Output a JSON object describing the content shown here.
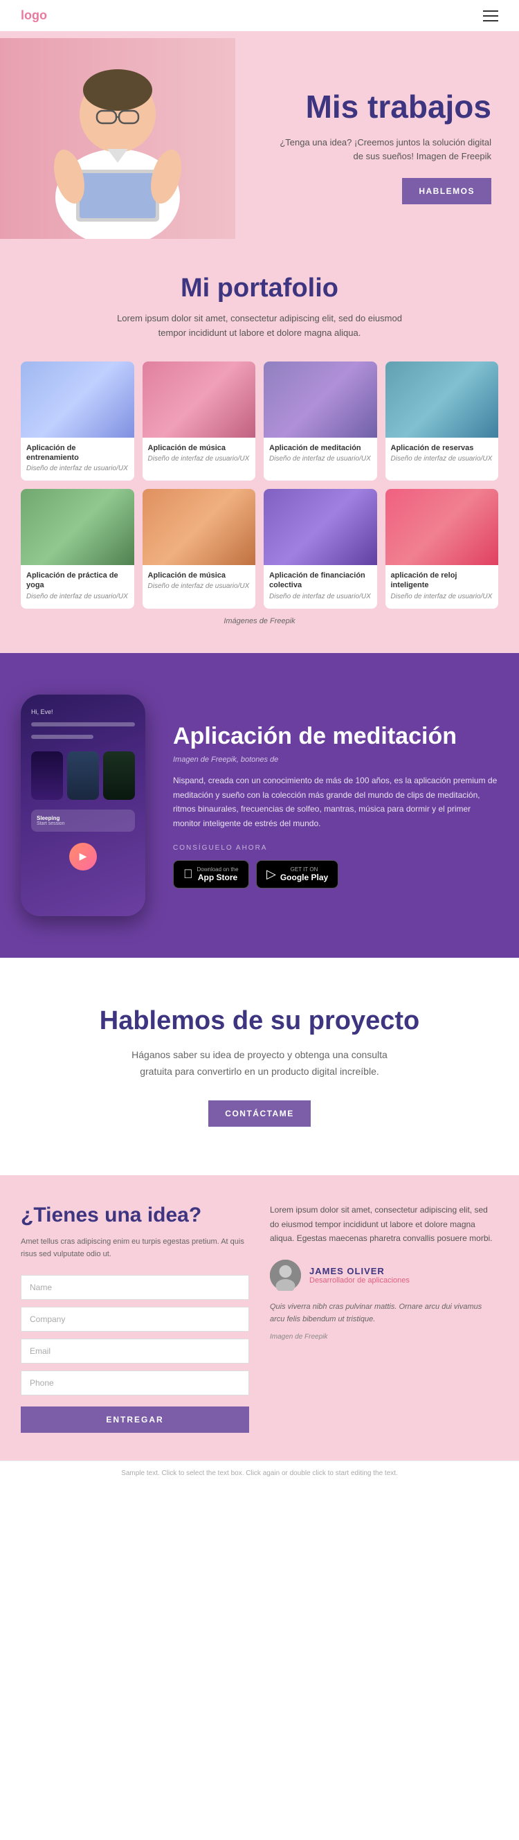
{
  "header": {
    "logo": "logo",
    "menu_icon": "≡"
  },
  "hero": {
    "title": "Mis trabajos",
    "subtitle": "¿Tenga una idea? ¡Creemos juntos la solución digital de sus sueños! Imagen de Freepik",
    "cta_button": "HABLEMOS"
  },
  "portfolio": {
    "title": "Mi portafolio",
    "subtitle": "Lorem ipsum dolor sit amet, consectetur adipiscing elit, sed do eiusmod tempor incididunt ut labore et dolore magna aliqua.",
    "cards_row1": [
      {
        "id": "card-1",
        "title": "Aplicación de entrenamiento",
        "desc": "Diseño de interfaz de usuario/UX",
        "color_class": "blue"
      },
      {
        "id": "card-2",
        "title": "Aplicación de música",
        "desc": "Diseño de interfaz de usuario/UX",
        "color_class": "pink"
      },
      {
        "id": "card-3",
        "title": "Aplicación de meditación",
        "desc": "Diseño de interfaz de usuario/UX",
        "color_class": "purple"
      },
      {
        "id": "card-4",
        "title": "Aplicación de reservas",
        "desc": "Diseño de interfaz de usuario/UX",
        "color_class": "teal"
      }
    ],
    "cards_row2": [
      {
        "id": "card-5",
        "title": "Aplicación de práctica de yoga",
        "desc": "Diseño de interfaz de usuario/UX",
        "color_class": "green"
      },
      {
        "id": "card-6",
        "title": "Aplicación de música",
        "desc": "Diseño de interfaz de usuario/UX",
        "color_class": "orange"
      },
      {
        "id": "card-7",
        "title": "Aplicación de financiación colectiva",
        "desc": "Diseño de interfaz de usuario/UX",
        "color_class": "violet"
      },
      {
        "id": "card-8",
        "title": "aplicación de reloj inteligente",
        "desc": "Diseño de interfaz de usuario/UX",
        "color_class": "coral"
      }
    ],
    "footer_credit": "Imágenes de Freepik"
  },
  "meditation": {
    "title": "Aplicación de meditación",
    "source": "Imagen de Freepik, botones de",
    "description": "Nispand, creada con un conocimiento de más de 100 años, es la aplicación premium de meditación y sueño con la colección más grande del mundo de clips de meditación, ritmos binaurales, frecuencias de solfeo, mantras, música para dormir y el primer monitor inteligente de estrés del mundo.",
    "consigue_label": "CONSÍGUELO AHORA",
    "app_store_label": "App Store",
    "app_store_small": "Download on the",
    "google_play_label": "Google Play",
    "google_play_small": "GET IT ON",
    "phone": {
      "greeting": "Hi, Eve!",
      "bar1": "",
      "bar2": "",
      "card_title": "Sleeping",
      "card_sub": "Start session"
    }
  },
  "contact": {
    "title": "Hablemos de su proyecto",
    "subtitle": "Háganos saber su idea de proyecto y obtenga una consulta gratuita para convertirlo en un producto digital increíble.",
    "cta_button": "CONTÁCTAME"
  },
  "bottom": {
    "left_title": "¿Tienes una idea?",
    "left_desc": "Amet tellus cras adipiscing enim eu turpis egestas pretium. At quis risus sed vulputate odio ut.",
    "form": {
      "name_placeholder": "Name",
      "company_placeholder": "Company",
      "email_placeholder": "Email",
      "phone_placeholder": "Phone",
      "submit_label": "ENTREGAR"
    },
    "right_text": "Lorem ipsum dolor sit amet, consectetur adipiscing elit, sed do eiusmod tempor incididunt ut labore et dolore magna aliqua. Egestas maecenas pharetra convallis posuere morbi.",
    "author": {
      "name": "JAMES OLIVER",
      "role": "Desarrollador de aplicaciones"
    },
    "quote": "Quis viverra nibh cras pulvinar mattis. Ornare arcu dui vivamus arcu felis bibendum ut tristique.",
    "image_credit": "Imagen de Freepik"
  },
  "footer": {
    "text": "Sample text. Click to select the text box. Click again or double click to start editing the text."
  }
}
